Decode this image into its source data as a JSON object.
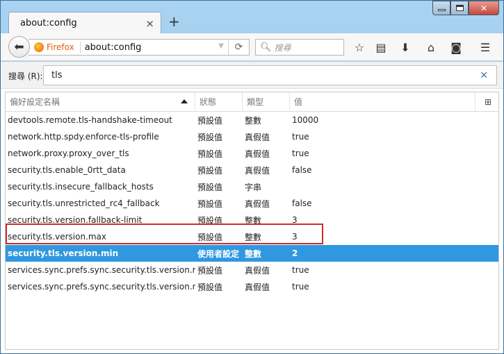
{
  "window": {
    "tab_title": "about:config",
    "new_tab_symbol": "+",
    "close_tab_symbol": "×",
    "minimize_symbol": "",
    "maximize_symbol": "",
    "close_symbol": "✕"
  },
  "navbar": {
    "identity_label": "Firefox",
    "url": "about:config",
    "search_placeholder": "搜尋",
    "icons": [
      "back-arrow-icon",
      "reload-icon",
      "search-icon",
      "bookmark-star-icon",
      "reading-list-icon",
      "download-icon",
      "home-icon",
      "pocket-icon",
      "menu-icon"
    ]
  },
  "filter": {
    "label": "搜尋 (R):",
    "value": "tls"
  },
  "columns": {
    "name": "偏好設定名稱",
    "status": "狀態",
    "type": "類型",
    "value": "值"
  },
  "rows": [
    {
      "name": "devtools.remote.tls-handshake-timeout",
      "status": "預設值",
      "type": "整數",
      "value": "10000"
    },
    {
      "name": "network.http.spdy.enforce-tls-profile",
      "status": "預設值",
      "type": "真假值",
      "value": "true"
    },
    {
      "name": "network.proxy.proxy_over_tls",
      "status": "預設值",
      "type": "真假值",
      "value": "true"
    },
    {
      "name": "security.tls.enable_0rtt_data",
      "status": "預設值",
      "type": "真假值",
      "value": "false"
    },
    {
      "name": "security.tls.insecure_fallback_hosts",
      "status": "預設值",
      "type": "字串",
      "value": ""
    },
    {
      "name": "security.tls.unrestricted_rc4_fallback",
      "status": "預設值",
      "type": "真假值",
      "value": "false"
    },
    {
      "name": "security.tls.version.fallback-limit",
      "status": "預設值",
      "type": "整數",
      "value": "3"
    },
    {
      "name": "security.tls.version.max",
      "status": "預設值",
      "type": "整數",
      "value": "3"
    },
    {
      "name": "security.tls.version.min",
      "status": "使用者設定",
      "type": "整數",
      "value": "2"
    },
    {
      "name": "services.sync.prefs.sync.security.tls.version.max",
      "status": "預設值",
      "type": "真假值",
      "value": "true"
    },
    {
      "name": "services.sync.prefs.sync.security.tls.version.min",
      "status": "預設值",
      "type": "真假值",
      "value": "true"
    }
  ],
  "selected_row_index": 8,
  "colors": {
    "selection": "#2f98e0",
    "highlight_border": "#d32a2a",
    "firefox_orange": "#e55b0a"
  }
}
